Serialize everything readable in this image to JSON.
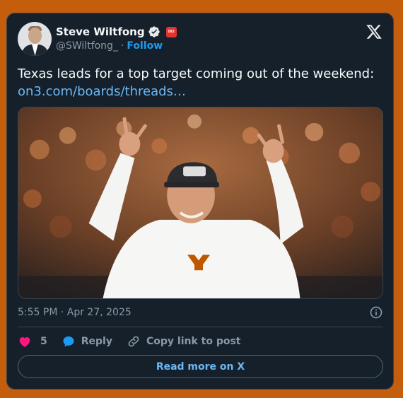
{
  "author": {
    "name": "Steve Wiltfong",
    "handle": "@SWiltfong_",
    "separator": "·",
    "follow_label": "Follow",
    "verified_icon": "verified-badge-icon",
    "org_badge_text": "ON3"
  },
  "tweet": {
    "text": "Texas leads for a top target coming out of the weekend: ",
    "link_text": "on3.com/boards/threads…"
  },
  "media": {
    "description_icon": "photo"
  },
  "meta": {
    "timestamp": "5:55 PM · Apr 27, 2025"
  },
  "actions": {
    "like_count": "5",
    "reply_label": "Reply",
    "copy_label": "Copy link to post"
  },
  "footer": {
    "read_more_label": "Read more on X"
  },
  "colors": {
    "background": "#c45d0c",
    "card": "#15202b",
    "accent": "#1d9bf0",
    "like": "#f91880",
    "reply": "#1d9bf0"
  }
}
